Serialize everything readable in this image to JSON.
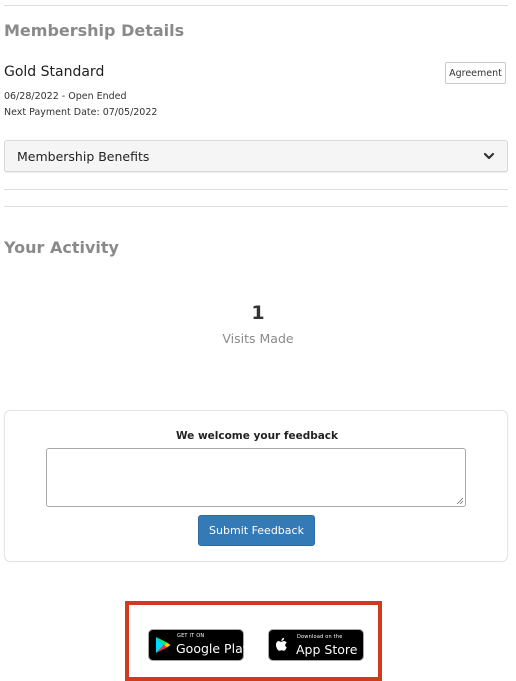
{
  "membership": {
    "section_title": "Membership Details",
    "plan_name": "Gold Standard",
    "agreement_label": "Agreement",
    "date_range": "06/28/2022 - Open Ended",
    "next_payment": "Next Payment Date: 07/05/2022",
    "benefits_label": "Membership Benefits"
  },
  "activity": {
    "section_title": "Your Activity",
    "visits_count": "1",
    "visits_label": "Visits Made"
  },
  "feedback": {
    "title": "We welcome your feedback",
    "textarea_value": "",
    "submit_label": "Submit Feedback"
  },
  "app_badges": {
    "google_play_small": "GET IT ON",
    "google_play_big": "Google Play",
    "app_store_small": "Download on the",
    "app_store_big": "App Store"
  },
  "colors": {
    "primary_button": "#337ab7",
    "highlight_border": "#d23a1f",
    "muted_heading": "#8a8a8a"
  },
  "icons": {
    "benefits_toggle": "chevron-down-icon",
    "google_play": "google-play-icon",
    "app_store": "apple-icon"
  }
}
